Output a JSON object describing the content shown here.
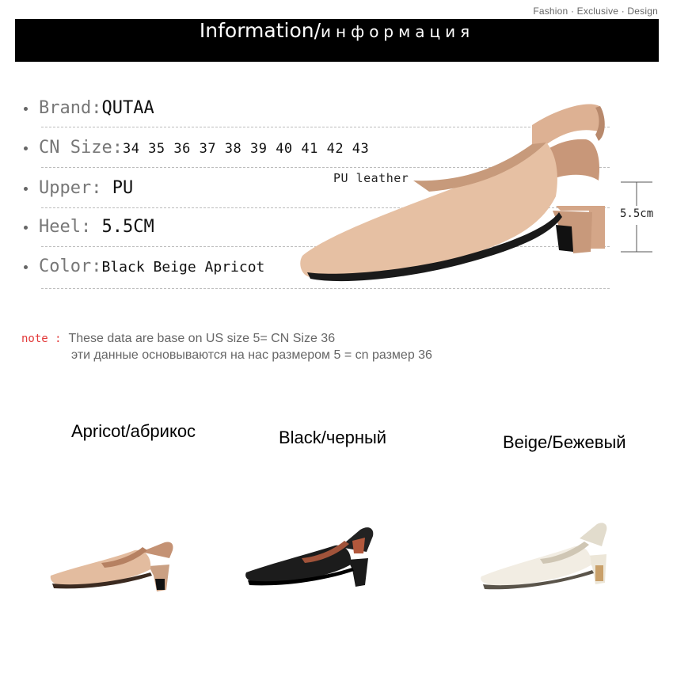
{
  "header": {
    "tagline": "Fashion · Exclusive · Design",
    "title_en": "Information/",
    "title_ru": "информация"
  },
  "specs": [
    {
      "label": "Brand:",
      "value": "QUTAA"
    },
    {
      "label": "CN Size:",
      "value": "34 35 36 37 38 39 40 41 42 43"
    },
    {
      "label": "Upper: ",
      "value": "PU"
    },
    {
      "label": "Heel: ",
      "value": "5.5CM"
    },
    {
      "label": "Color:",
      "value": "Black Beige Apricot"
    }
  ],
  "product_image": {
    "material_label": "PU leather",
    "heel_height_label": "5.5cm"
  },
  "note": {
    "tag": "note :",
    "line_en": "These data are base on US size 5= CN Size 36",
    "line_ru": "эти данные основываются на нас размером 5 = cn размер 36"
  },
  "colors": [
    {
      "name": "Apricot/абрикос",
      "hex": "#e3bc9f"
    },
    {
      "name": "Black/черный",
      "hex": "#1c1c1c"
    },
    {
      "name": "Beige/Бежевый",
      "hex": "#efe9dc"
    }
  ]
}
